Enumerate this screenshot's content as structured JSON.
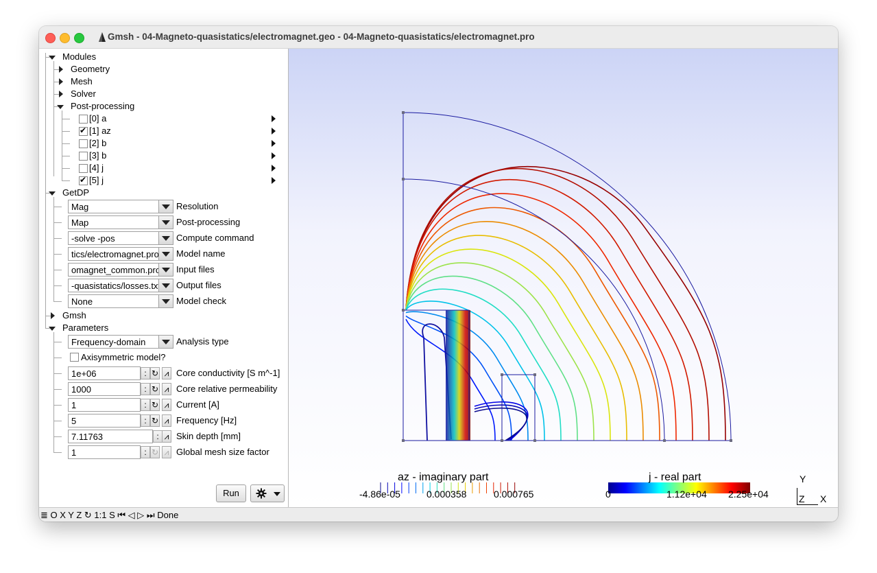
{
  "window": {
    "title": "Gmsh - 04-Magneto-quasistatics/electromagnet.geo - 04-Magneto-quasistatics/electromagnet.pro"
  },
  "tree": {
    "modules": "Modules",
    "geometry": "Geometry",
    "mesh": "Mesh",
    "solver": "Solver",
    "post_processing": "Post-processing",
    "views": [
      {
        "label": "[0] a",
        "checked": false
      },
      {
        "label": "[1] az",
        "checked": true
      },
      {
        "label": "[2] b",
        "checked": false
      },
      {
        "label": "[3] b",
        "checked": false
      },
      {
        "label": "[4] j",
        "checked": false
      },
      {
        "label": "[5] j",
        "checked": true
      }
    ],
    "getdp": "GetDP",
    "gmsh": "Gmsh",
    "parameters": "Parameters"
  },
  "getdp": [
    {
      "value": "Mag",
      "label": "Resolution"
    },
    {
      "value": "Map",
      "label": "Post-processing"
    },
    {
      "value": "-solve -pos",
      "label": "Compute command"
    },
    {
      "value": "tics/electromagnet.pro",
      "label": "Model name"
    },
    {
      "value": "omagnet_common.pro",
      "label": "Input files"
    },
    {
      "value": "-quasistatics/losses.txt",
      "label": "Output files"
    },
    {
      "value": "None",
      "label": "Model check"
    }
  ],
  "parameters": {
    "analysis_value": "Frequency-domain",
    "analysis_label": "Analysis type",
    "axisymmetric_label": "Axisymmetric model?",
    "axisymmetric_checked": false,
    "fields": [
      {
        "value": "1e+06",
        "label": "Core conductivity [S m^-1]"
      },
      {
        "value": "1000",
        "label": "Core relative permeability"
      },
      {
        "value": "1",
        "label": "Current [A]"
      },
      {
        "value": "5",
        "label": "Frequency [Hz]"
      },
      {
        "value": "7.11763",
        "label": "Skin depth [mm]"
      },
      {
        "value": "1",
        "label": "Global mesh size factor"
      }
    ],
    "sep": ":",
    "loop_icon": "↻",
    "graph_icon": "⩘"
  },
  "buttons": {
    "run": "Run",
    "gear_icon": "gear-icon"
  },
  "status": {
    "toolbar": "≣ O X Y Z ↻ 1:1 S",
    "nav": "⏮ ◁ ▷ ⏭",
    "message": "Done"
  },
  "scales": {
    "az_title": "az - imaginary part",
    "az_ticks": [
      "-4.86e-05",
      "0.000358",
      "0.000765"
    ],
    "j_title": "j - real part",
    "j_ticks": [
      "0",
      "1.12e+04",
      "2.25e+04"
    ]
  },
  "axes": {
    "y": "Y",
    "z": "Z",
    "x": "X"
  },
  "colors": {
    "contour_low": "#1010a0",
    "contour_high": "#b00000",
    "background_top": "#ccd4f6"
  }
}
